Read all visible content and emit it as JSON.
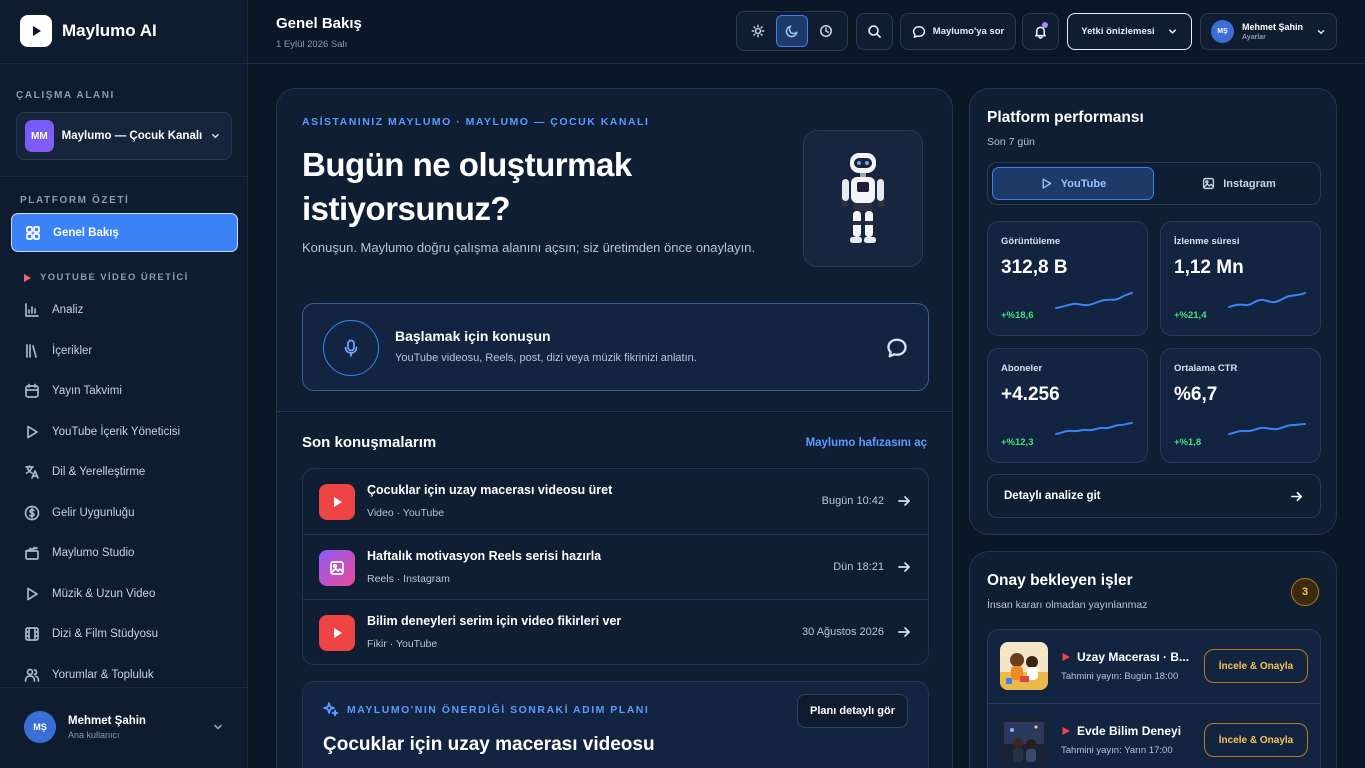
{
  "app": {
    "name": "Maylumo AI"
  },
  "sidebar": {
    "workspace_label": "ÇALIŞMA ALANI",
    "workspace": {
      "initials": "MM",
      "name": "Maylumo — Çocuk Kanalı"
    },
    "platform_label": "PLATFORM ÖZETİ",
    "active_item": "Genel Bakış",
    "yt_section_label": "YOUTUBE VİDEO ÜRETİCİ",
    "items": [
      {
        "label": "Analiz",
        "icon": "chart-icon"
      },
      {
        "label": "İçerikler",
        "icon": "library-icon"
      },
      {
        "label": "Yayın Takvimi",
        "icon": "calendar-icon"
      },
      {
        "label": "YouTube İçerik Yöneticisi",
        "icon": "play-icon"
      },
      {
        "label": "Dil & Yerelleştirme",
        "icon": "translate-icon"
      },
      {
        "label": "Gelir Uygunluğu",
        "icon": "dollar-icon"
      },
      {
        "label": "Maylumo Studio",
        "icon": "clapper-icon"
      },
      {
        "label": "Müzik & Uzun Video",
        "icon": "play-icon"
      },
      {
        "label": "Dizi & Film Stüdyosu",
        "icon": "film-icon"
      },
      {
        "label": "Yorumlar & Topluluk",
        "icon": "users-icon"
      }
    ],
    "user": {
      "initials": "MŞ",
      "name": "Mehmet Şahin",
      "role": "Ana kullanıcı"
    }
  },
  "header": {
    "title": "Genel Bakış",
    "date": "1 Eylül 2026 Salı",
    "ask_label": "Maylumo'ya sor",
    "preview_label": "Yetki önizlemesi",
    "user": {
      "initials": "MŞ",
      "name": "Mehmet Şahin",
      "sub": "Ayarlar"
    }
  },
  "hero": {
    "eyebrow": "ASİSTANINIZ MAYLUMO · MAYLUMO — ÇOCUK KANALI",
    "title": "Bugün ne oluşturmak istiyorsunuz?",
    "subtitle": "Konuşun. Maylumo doğru çalışma alanını açsın; siz üretimden önce onaylayın.",
    "voice_title": "Başlamak için konuşun",
    "voice_sub": "YouTube videosu, Reels, post, dizi veya müzik fikrinizi anlatın."
  },
  "conversations": {
    "title": "Son konuşmalarım",
    "link": "Maylumo hafızasını aç",
    "items": [
      {
        "title": "Çocuklar için uzay macerası videosu üret",
        "meta": "Video · YouTube",
        "time": "Bugün 10:42",
        "type": "youtube"
      },
      {
        "title": "Haftalık motivasyon Reels serisi hazırla",
        "meta": "Reels · Instagram",
        "time": "Dün 18:21",
        "type": "instagram"
      },
      {
        "title": "Bilim deneyleri serim için video fikirleri ver",
        "meta": "Fikir · YouTube",
        "time": "30 Ağustos 2026",
        "type": "youtube"
      }
    ]
  },
  "plan": {
    "eyebrow": "MAYLUMO'NIN ÖNERDİĞİ SONRAKİ ADIM PLANI",
    "button": "Planı detaylı gör",
    "title": "Çocuklar için uzay macerası videosu"
  },
  "performance": {
    "title": "Platform performansı",
    "subtitle": "Son 7 gün",
    "tabs": [
      "YouTube",
      "Instagram"
    ],
    "metrics": [
      {
        "label": "Görüntüleme",
        "value": "312,8 B",
        "delta": "+%18,6"
      },
      {
        "label": "İzlenme süresi",
        "value": "1,12 Mn",
        "delta": "+%21,4"
      },
      {
        "label": "Aboneler",
        "value": "+4.256",
        "delta": "+%12,3"
      },
      {
        "label": "Ortalama CTR",
        "value": "%6,7",
        "delta": "+%1,8"
      }
    ],
    "detail_button": "Detaylı analize git",
    "colors": {
      "accent": "#3b82f6",
      "positive": "#4ade80"
    }
  },
  "approvals": {
    "title": "Onay bekleyen işler",
    "subtitle": "İnsan kararı olmadan yayınlanmaz",
    "count": "3",
    "items": [
      {
        "title": "Uzay Macerası · B...",
        "date": "Tahmini yayın: Bugün 18:00",
        "button": "İncele & Onayla"
      },
      {
        "title": "Evde Bilim Deneyi",
        "date": "Tahmini yayın: Yarın 17:00",
        "button": "İncele & Onayla"
      }
    ]
  }
}
